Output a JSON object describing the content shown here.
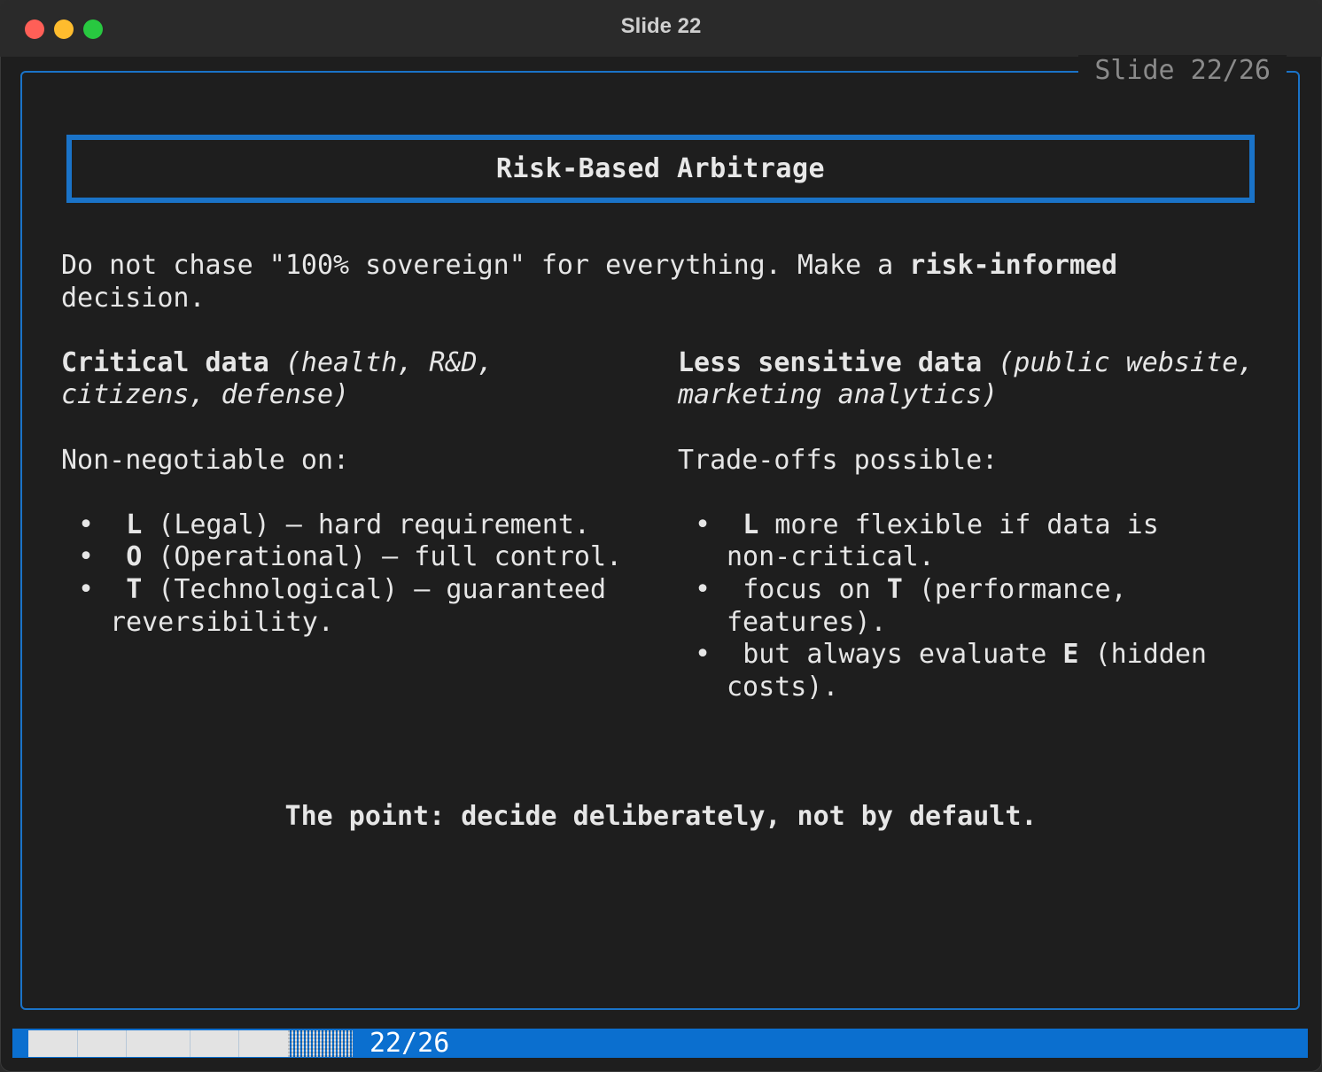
{
  "window": {
    "title": "Slide 22",
    "colors": {
      "accent": "#1a73c8",
      "background": "#1e1e1e",
      "text": "#e6e6e6",
      "statusbar": "#0b6fcf"
    }
  },
  "slide": {
    "frame_label": "Slide 22/26",
    "heading": "Risk-Based Arbitrage",
    "intro": {
      "part1": "Do not chase \"100% sovereign\" for everything. Make a ",
      "bold": "risk-informed",
      "part2": "decision."
    },
    "left": {
      "heading_bold": "Critical data",
      "heading_italic_1": " (health, R&D,",
      "heading_italic_2": "citizens, defense)",
      "lead": "Non-negotiable on:",
      "bullets": [
        {
          "key": "L",
          "text": " (Legal) — hard requirement."
        },
        {
          "key": "O",
          "text": " (Operational) — full control."
        },
        {
          "key": "T",
          "text": " (Technological) — guaranteed",
          "cont": "reversibility."
        }
      ]
    },
    "right": {
      "heading_bold": "Less sensitive data",
      "heading_italic_1": " (public website,",
      "heading_italic_2": "marketing analytics)",
      "lead": "Trade-offs possible:",
      "bullets": [
        {
          "pre": "",
          "key": "L",
          "text": " more flexible if data is",
          "cont": "non-critical."
        },
        {
          "pre": "focus on ",
          "key": "T",
          "text": " (performance,",
          "cont": "features)."
        },
        {
          "pre": "but always evaluate ",
          "key": "E",
          "text": " (hidden",
          "cont": "costs)."
        }
      ]
    },
    "conclusion": "The point: decide deliberately, not by default."
  },
  "statusbar": {
    "progress_text": "22/26",
    "progress": {
      "current": 22,
      "total": 26
    }
  }
}
